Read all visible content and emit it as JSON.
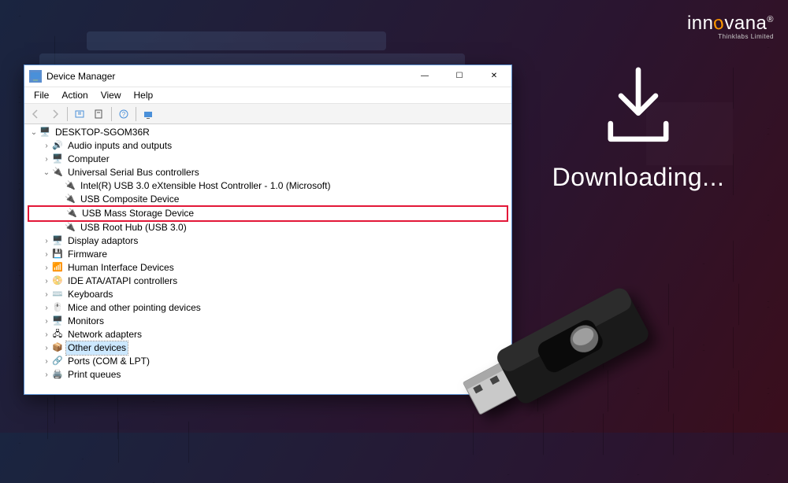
{
  "logo": {
    "brand": "inn",
    "brandAccent": "o",
    "brandRest": "vana",
    "reg": "®",
    "sub": "Thinklabs Limited"
  },
  "download": {
    "text": "Downloading..."
  },
  "window": {
    "title": "Device Manager",
    "menu": {
      "file": "File",
      "action": "Action",
      "view": "View",
      "help": "Help"
    },
    "controls": {
      "minimize": "—",
      "maximize": "☐",
      "close": "✕"
    },
    "tree": {
      "root": "DESKTOP-SGOM36R",
      "nodes": {
        "audio": "Audio inputs and outputs",
        "computer": "Computer",
        "usbControllers": "Universal Serial Bus controllers",
        "intelUsb": "Intel(R) USB 3.0 eXtensible Host Controller - 1.0 (Microsoft)",
        "usbComposite": "USB Composite Device",
        "usbMassStorage": "USB Mass Storage Device",
        "usbRootHub": "USB Root Hub (USB 3.0)",
        "displayAdaptors": "Display adaptors",
        "firmware": "Firmware",
        "hid": "Human Interface Devices",
        "ide": "IDE ATA/ATAPI controllers",
        "keyboards": "Keyboards",
        "mice": "Mice and other pointing devices",
        "monitors": "Monitors",
        "network": "Network adapters",
        "otherDevices": "Other devices",
        "ports": "Ports (COM & LPT)",
        "printQueues": "Print queues"
      }
    }
  }
}
